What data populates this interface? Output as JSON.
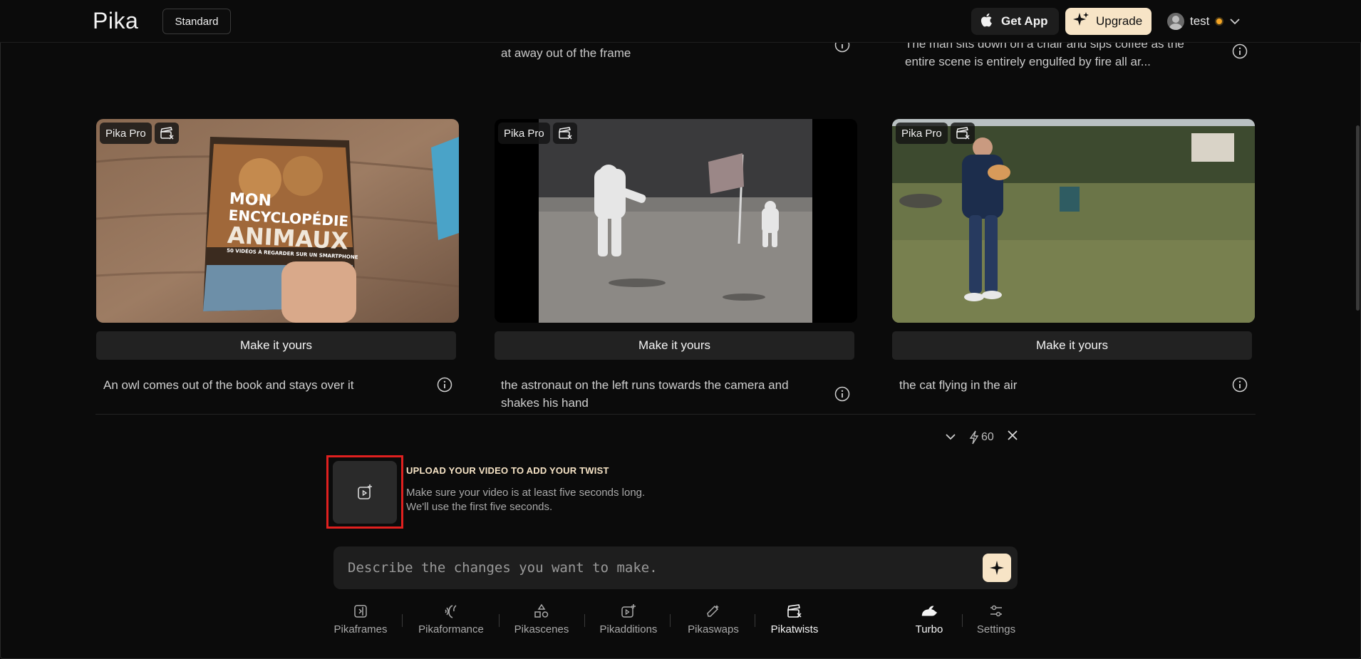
{
  "header": {
    "logo": "Pika",
    "plan": "Standard",
    "get_app": "Get App",
    "upgrade": "Upgrade",
    "username": "test"
  },
  "top_row": {
    "desc_2": "at away out of the frame",
    "desc_3_line1": "The man sits down on a chair and sips coffee as the",
    "desc_3_line2": "entire scene is entirely engulfed by fire all ar..."
  },
  "cards": [
    {
      "badge": "Pika Pro",
      "button": "Make it yours",
      "description": "An owl comes out of the book and stays over it",
      "book_title_1": "MON",
      "book_title_2": "ENCYCLOPÉDIE",
      "book_title_3": "ANIMAUX",
      "book_sub": "50 VIDÉOS À REGARDER SUR UN SMARTPHONE"
    },
    {
      "badge": "Pika Pro",
      "button": "Make it yours",
      "description_line1": "the astronaut on the left runs towards the camera and",
      "description_line2": "shakes his hand"
    },
    {
      "badge": "Pika Pro",
      "button": "Make it yours",
      "description": "the cat flying in the air"
    }
  ],
  "controls": {
    "credits": "60"
  },
  "upload": {
    "title": "UPLOAD YOUR VIDEO TO ADD YOUR TWIST",
    "line1": "Make sure your video is at least five seconds long.",
    "line2": "We'll use the first five seconds."
  },
  "prompt": {
    "placeholder": "Describe the changes you want to make."
  },
  "tools": {
    "pikaframes": "Pikaframes",
    "pikaformance": "Pikaformance",
    "pikascenes": "Pikascenes",
    "pikadditions": "Pikadditions",
    "pikaswaps": "Pikaswaps",
    "pikatwists": "Pikatwists",
    "turbo": "Turbo",
    "settings": "Settings"
  },
  "colors": {
    "accent": "#f7e4c6",
    "highlight_border": "#e0201f",
    "background": "#0b0b0b"
  }
}
